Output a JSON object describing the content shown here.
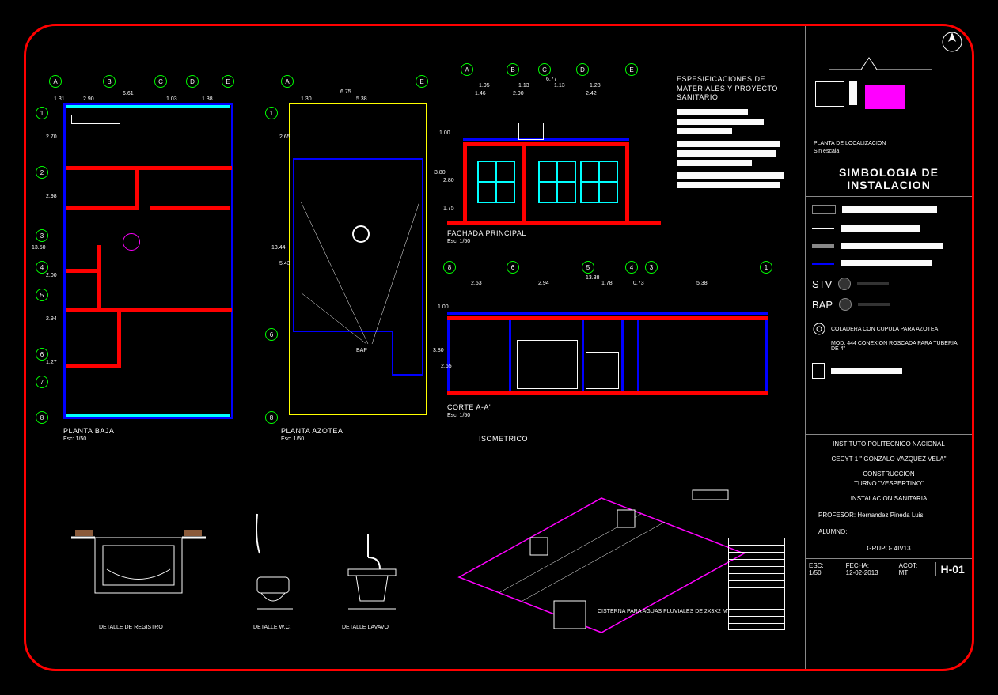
{
  "specs": {
    "title": "ESPESIFICACIONES DE\nMATERIALES Y PROYECTO\nSANITARIO"
  },
  "locPlan": {
    "label": "PLANTA DE LOCALIZACION",
    "scale": "Sin escala"
  },
  "symbology": {
    "title": "SIMBOLOGIA DE\nINSTALACION",
    "stv": "STV",
    "bap": "BAP",
    "drain": "COLADERA CON CUPULA PARA AZOTEA",
    "conn": "MOD. 444 CONEXION ROSCADA PARA TUBERIA DE 4\""
  },
  "titleBlock": {
    "school": "INSTITUTO POLITECNICO NACIONAL",
    "campus": "CECYT 1 \" GONZALO VAZQUEZ VELA\"",
    "program": "CONSTRUCCION\nTURNO \"VESPERTINO\"",
    "project": "INSTALACION SANITARIA",
    "profLabel": "PROFESOR:",
    "prof": "Hernandez Pineda Luis",
    "studentLabel": "ALUMNO:",
    "groupLabel": "GRUPO-",
    "group": "4IV13",
    "escLabel": "ESC:",
    "esc": "1/50",
    "dateLabel": "FECHA:",
    "date": "12-02-2013",
    "unitLabel": "ACOT:",
    "unit": "MT",
    "sheet": "H-01"
  },
  "planBaja": {
    "title": "PLANTA BAJA",
    "scale": "Esc: 1/50",
    "axesH": [
      "A",
      "B",
      "C",
      "D",
      "E"
    ],
    "axesV": [
      "1",
      "2",
      "3",
      "4",
      "5",
      "6",
      "7",
      "8"
    ],
    "dimsTop": [
      "1.31",
      "2.90",
      "6.61",
      "1.03",
      "1.38"
    ],
    "dimsLeft": [
      "2.70",
      "2.98",
      "13.50",
      "2.00",
      "2.94",
      "1.27"
    ]
  },
  "azotea": {
    "title": "PLANTA AZOTEA",
    "scale": "Esc: 1/50",
    "axesH": [
      "A",
      "E"
    ],
    "axesV": [
      "1",
      "8"
    ],
    "dimTop": "5.38",
    "dimTotal": "6.75",
    "dimLeft": "5.43",
    "dimLeft2": "2.65",
    "dimTotal2": "13.44",
    "dimSide": "1.30",
    "bap": "BAP"
  },
  "facade": {
    "title": "FACHADA PRINCIPAL",
    "scale": "Esc: 1/50",
    "axesH": [
      "A",
      "B",
      "C",
      "D",
      "E"
    ],
    "dims": [
      "1.95",
      "1.13",
      "6.77",
      "1.13",
      "1.28"
    ],
    "dims2": [
      "1.46",
      "2.90",
      "2.42"
    ],
    "hDims": [
      "1.00",
      "3.80",
      "2.80",
      "1.75"
    ]
  },
  "corte": {
    "title": "CORTE A-A'",
    "scale": "Esc: 1/50",
    "axesH": [
      "8",
      "6",
      "5",
      "4",
      "3",
      "1"
    ],
    "dims": [
      "2.53",
      "2.94",
      "13.38",
      "1.78",
      "0.73",
      "5.38"
    ],
    "hDims": [
      "1.00",
      "3.80",
      "2.65"
    ]
  },
  "iso": {
    "title": "ISOMETRICO",
    "cistern": "CISTERNA PARA AGUAS PLUVIALES DE 2X3X2 MT"
  },
  "details": {
    "registro": "DETALLE DE REGISTRO",
    "wc": "DETALLE W.C.",
    "lavabo": "DETALLE LAVAVO"
  }
}
